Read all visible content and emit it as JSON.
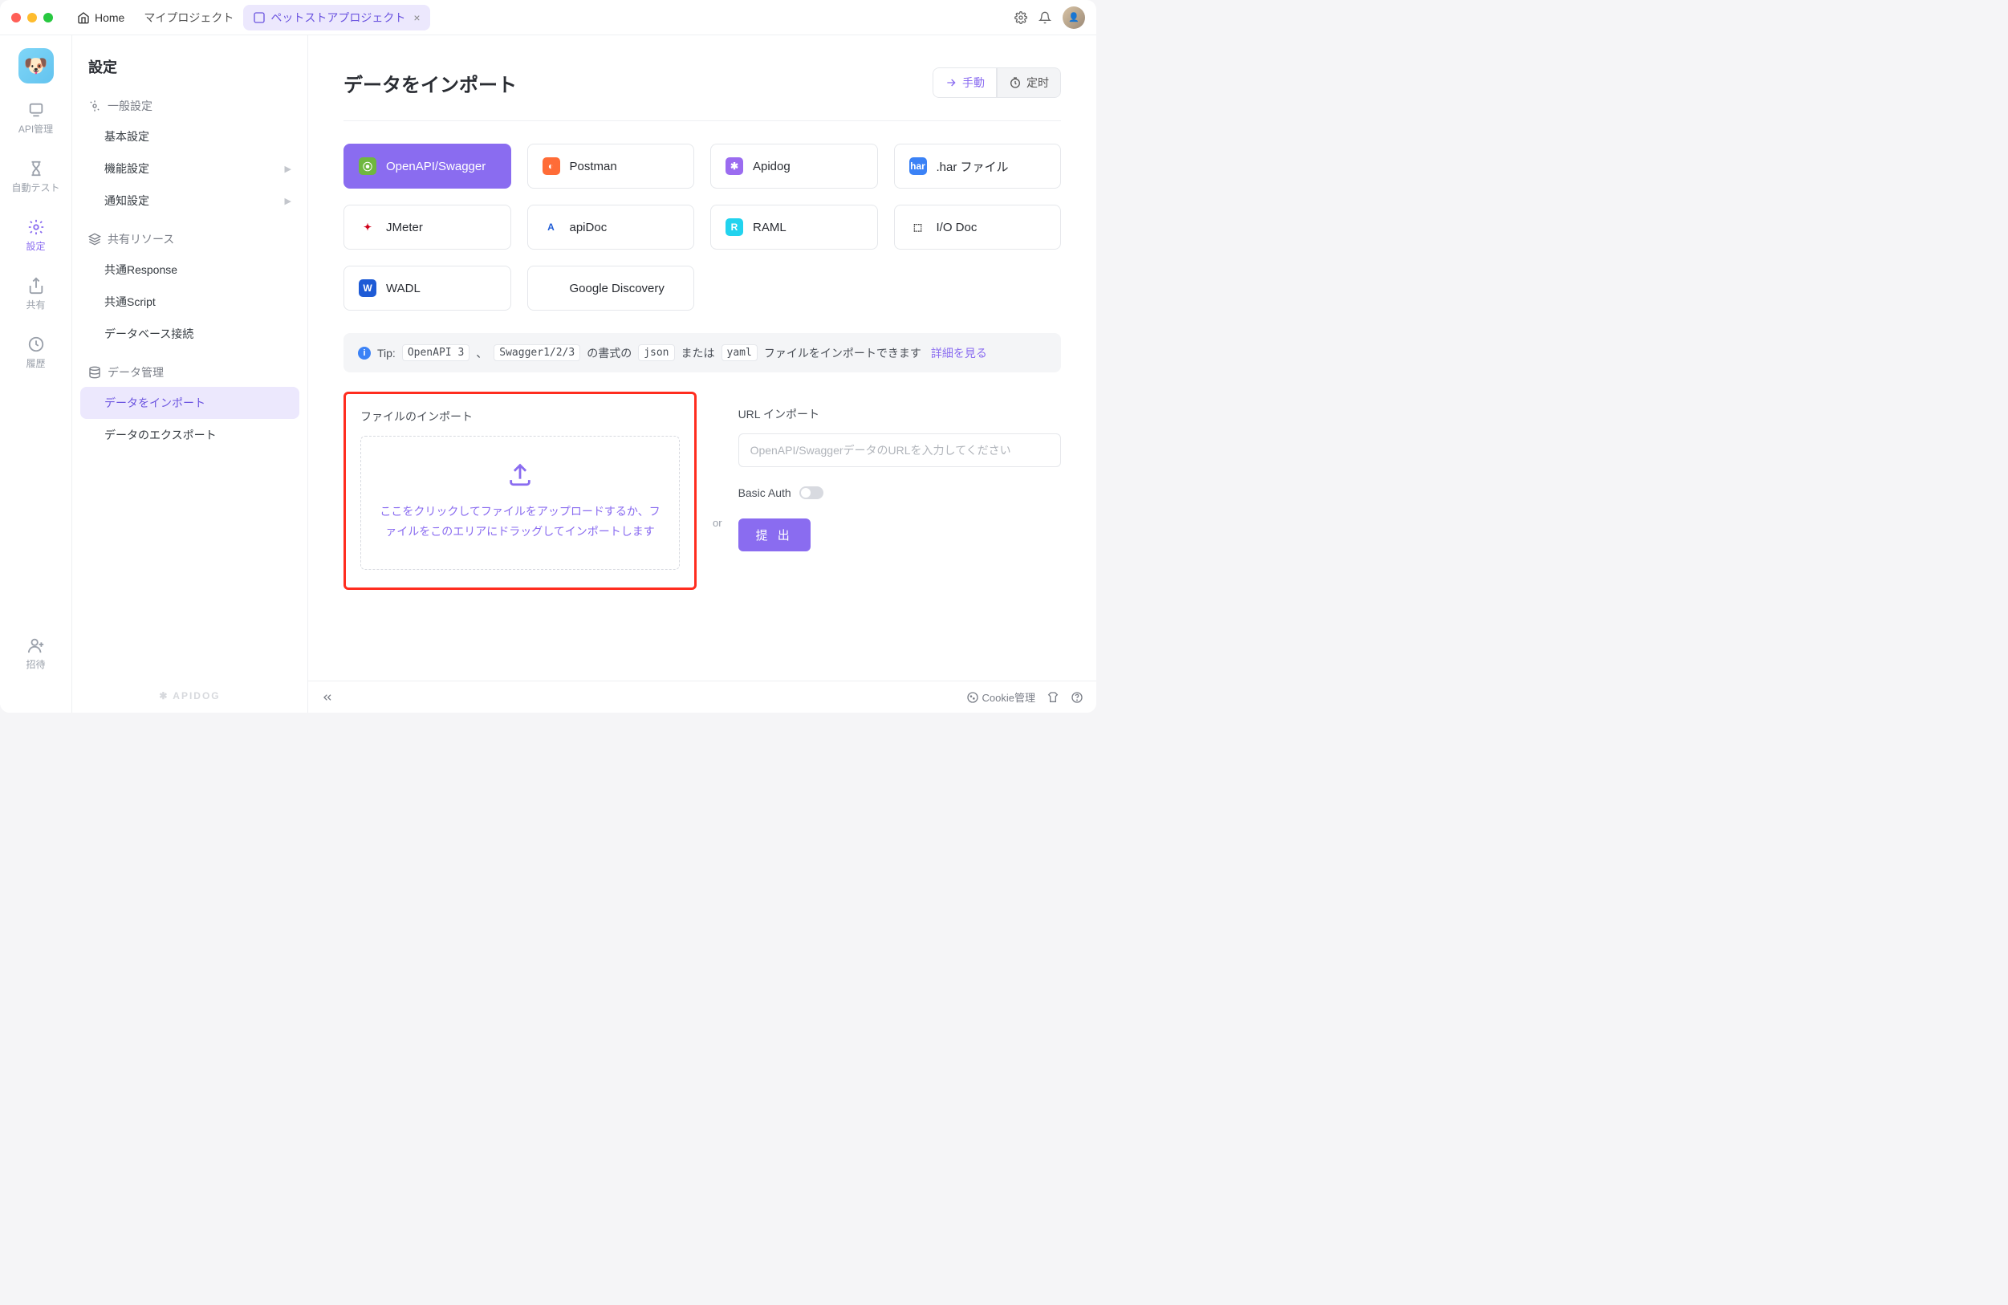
{
  "titlebar": {
    "home": "Home",
    "project": "マイプロジェクト",
    "active_tab": "ペットストアプロジェクト"
  },
  "rail": {
    "api": "API管理",
    "autotest": "自動テスト",
    "settings": "設定",
    "share": "共有",
    "history": "履歴",
    "invite": "招待"
  },
  "sidebar": {
    "title": "設定",
    "group_general": "一般設定",
    "item_basic": "基本設定",
    "item_feature": "機能設定",
    "item_notify": "通知設定",
    "group_shared": "共有リソース",
    "item_response": "共通Response",
    "item_script": "共通Script",
    "item_db": "データベース接続",
    "group_data": "データ管理",
    "item_import": "データをインポート",
    "item_export": "データのエクスポート",
    "brand": "✱ APIDOG"
  },
  "main": {
    "heading": "データをインポート",
    "seg_manual": "手動",
    "seg_scheduled": "定时",
    "cards": {
      "openapi": "OpenAPI/Swagger",
      "postman": "Postman",
      "apidog": "Apidog",
      "har": ".har ファイル",
      "jmeter": "JMeter",
      "apidoc": "apiDoc",
      "raml": "RAML",
      "iodoc": "I/O Doc",
      "wadl": "WADL",
      "gdisc": "Google Discovery"
    },
    "tip": {
      "label": "Tip:",
      "code1": "OpenAPI 3",
      "sep1": "、",
      "code2": "Swagger1/2/3",
      "mid1": "の書式の",
      "code3": "json",
      "mid2": "または",
      "code4": "yaml",
      "tail": "ファイルをインポートできます",
      "link": "詳細を見る"
    },
    "file_title": "ファイルのインポート",
    "dropzone_text": "ここをクリックしてファイルをアップロードするか、ファイルをこのエリアにドラッグしてインポートします",
    "or": "or",
    "url_title": "URL インポート",
    "url_placeholder": "OpenAPI/SwaggerデータのURLを入力してください",
    "basic_auth": "Basic Auth",
    "submit": "提 出"
  },
  "statusbar": {
    "cookie": "Cookie管理"
  }
}
